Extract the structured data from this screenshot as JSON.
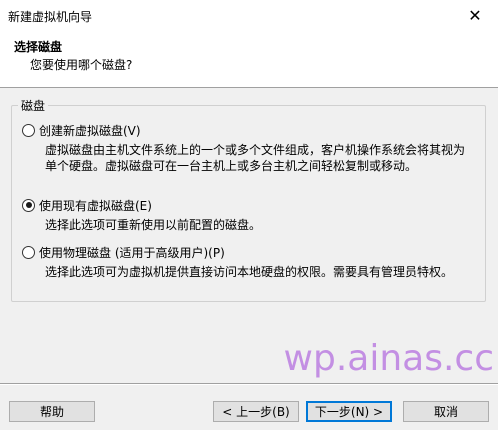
{
  "window": {
    "title": "新建虚拟机向导",
    "close_glyph": "✕"
  },
  "header": {
    "title": "选择磁盘",
    "subtitle": "您要使用哪个磁盘?"
  },
  "group": {
    "legend": "磁盘",
    "options": [
      {
        "label": "创建新虚拟磁盘(V)",
        "selected": false,
        "description_line1": "虚拟磁盘由主机文件系统上的一个或多个文件组成，客户机操作系统会将其视为",
        "description_line2": "单个硬盘。虚拟磁盘可在一台主机上或多台主机之间轻松复制或移动。"
      },
      {
        "label": "使用现有虚拟磁盘(E)",
        "selected": true,
        "description_line1": "选择此选项可重新使用以前配置的磁盘。"
      },
      {
        "label": "使用物理磁盘 (适用于高级用户)(P)",
        "selected": false,
        "description_line1": "选择此选项可为虚拟机提供直接访问本地硬盘的权限。需要具有管理员特权。"
      }
    ]
  },
  "buttons": {
    "help": "帮助",
    "back": "< 上一步(B)",
    "next": "下一步(N) >",
    "cancel": "取消"
  },
  "watermark": "wp.ainas.cc"
}
